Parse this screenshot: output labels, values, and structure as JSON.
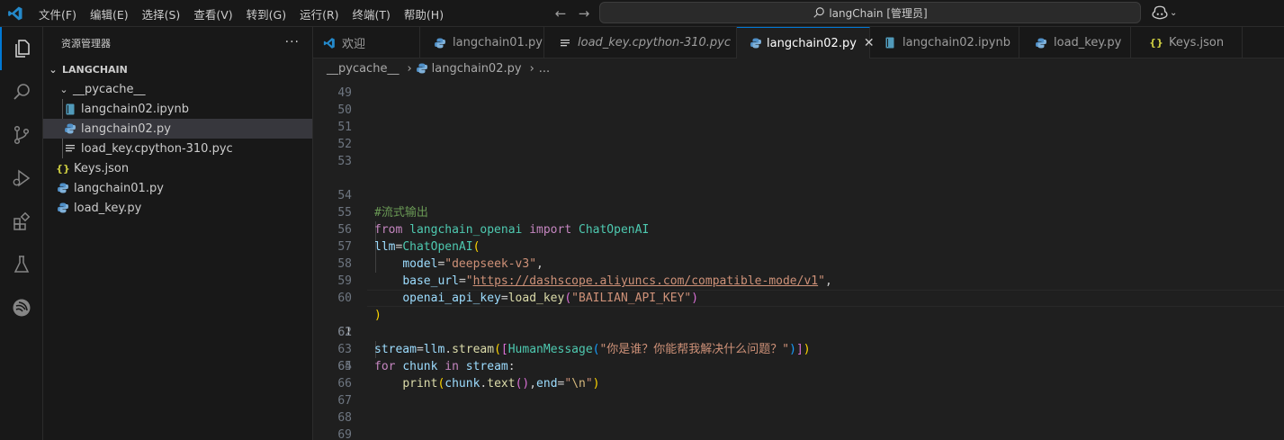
{
  "menu": [
    "文件(F)",
    "编辑(E)",
    "选择(S)",
    "查看(V)",
    "转到(G)",
    "运行(R)",
    "终端(T)",
    "帮助(H)"
  ],
  "search": {
    "text": "langChain [管理员]"
  },
  "sidebar": {
    "title": "资源管理器",
    "more": "···",
    "root": "LANGCHAIN",
    "items": [
      {
        "label": "__pycache__"
      },
      {
        "label": "langchain02.ipynb"
      },
      {
        "label": "langchain02.py"
      },
      {
        "label": "load_key.cpython-310.pyc"
      },
      {
        "label": "Keys.json"
      },
      {
        "label": "langchain01.py"
      },
      {
        "label": "load_key.py"
      }
    ]
  },
  "tabs": [
    {
      "label": "欢迎"
    },
    {
      "label": "langchain01.py"
    },
    {
      "label": "load_key.cpython-310.pyc"
    },
    {
      "label": "langchain02.py"
    },
    {
      "label": "langchain02.ipynb"
    },
    {
      "label": "load_key.py"
    },
    {
      "label": "Keys.json"
    }
  ],
  "breadcrumb": [
    "__pycache__",
    "langchain02.py",
    "..."
  ],
  "editor": {
    "line_numbers": [
      "49",
      "50",
      "51",
      "52",
      "53",
      "54",
      "55",
      "56",
      "57",
      "58",
      "59",
      "60",
      "61",
      "62",
      "63",
      "64",
      "65",
      "66",
      "67",
      "68",
      "69"
    ],
    "code": {
      "l54": "#流式输出",
      "from": "from",
      "langchain_openai": "langchain_openai",
      "import": "import",
      "ChatOpenAI": "ChatOpenAI",
      "llm": "llm",
      "eq": "=",
      "ChatOpenAI2": "ChatOpenAI",
      "p_open": "(",
      "model": "model",
      "model_val": "\"deepseek-v3\"",
      "comma": ",",
      "base_url": "base_url",
      "q1": "\"",
      "url": "https://dashscope.aliyuncs.com/compatible-mode/v1",
      "q2": "\"",
      "comma2": ",",
      "openai_api_key": "openai_api_key",
      "load_key": "load_key",
      "lk_open": "(",
      "key_val": "\"BAILIAN_API_KEY\"",
      "lk_close": ")",
      "p_close": ")",
      "stream": "stream",
      "eq2": "=",
      "llm2": "llm",
      "dot": ".",
      "stream_fn": "stream",
      "s_open": "(",
      "b_open": "[",
      "HumanMessage": "HumanMessage",
      "h_open": "(",
      "msg": "\"你是谁？你能帮我解决什么问题？\"",
      "h_close": ")",
      "b_close": "]",
      "s_close": ")",
      "for": "for",
      "chunk": "chunk",
      "in": "in",
      "stream2": "stream",
      "colon": ":",
      "print": "print",
      "pr_open": "(",
      "chunk2": "chunk",
      "dot2": ".",
      "text": "text",
      "t_paren": "()",
      "comma3": ",",
      "end": "end",
      "eq3": "=",
      "nq1": "\"",
      "nl": "\\n",
      "nq2": "\"",
      "pr_close": ")"
    }
  }
}
